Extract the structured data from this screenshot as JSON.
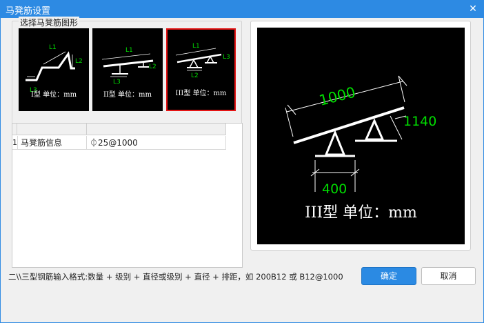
{
  "window": {
    "title": "马凳筋设置",
    "close_glyph": "✕"
  },
  "group": {
    "legend": "选择马凳筋图形"
  },
  "thumbnails": [
    {
      "label": "I型 单位：mm",
      "dims": [
        "L1",
        "L2",
        "L3"
      ],
      "selected": false
    },
    {
      "label": "II型 单位：mm",
      "dims": [
        "L1",
        "L2",
        "L3"
      ],
      "selected": false
    },
    {
      "label": "III型 单位：mm",
      "dims": [
        "L1",
        "L2",
        "L3"
      ],
      "selected": true
    }
  ],
  "table": {
    "rows": [
      {
        "num": "1",
        "name": "马凳筋信息",
        "value": "⏀25@1000"
      }
    ]
  },
  "preview": {
    "label": "III型 单位：mm",
    "dim_top": "1000",
    "dim_right": "1140",
    "dim_bottom": "400"
  },
  "hint": "二\\\\三型钢筋输入格式:数量 + 级别 + 直径或级别 + 直径 + 排距，如 200B12 或 B12@1000",
  "buttons": {
    "ok": "确定",
    "cancel": "取消"
  },
  "colors": {
    "accent": "#2d8ae3",
    "selected_border": "#e51414",
    "dimension_text": "#00dd00"
  },
  "icons": {
    "close": "close-icon"
  }
}
